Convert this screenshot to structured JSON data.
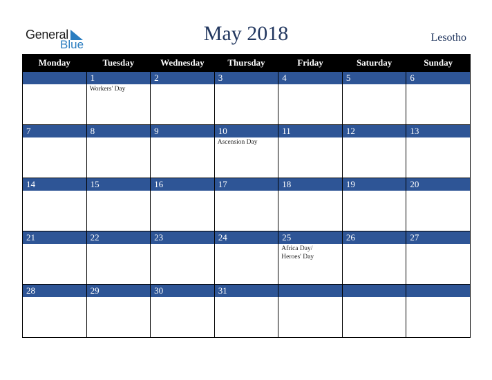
{
  "logo": {
    "line1": "General",
    "line2": "Blue"
  },
  "header": {
    "title": "May 2018",
    "country": "Lesotho"
  },
  "colors": {
    "header_bg": "#000000",
    "date_bar": "#2e5596",
    "title": "#22375f",
    "logo_blue": "#2a7dc0"
  },
  "weekdays": [
    "Monday",
    "Tuesday",
    "Wednesday",
    "Thursday",
    "Friday",
    "Saturday",
    "Sunday"
  ],
  "weeks": [
    [
      {
        "day": "",
        "holiday": ""
      },
      {
        "day": "1",
        "holiday": "Workers' Day"
      },
      {
        "day": "2",
        "holiday": ""
      },
      {
        "day": "3",
        "holiday": ""
      },
      {
        "day": "4",
        "holiday": ""
      },
      {
        "day": "5",
        "holiday": ""
      },
      {
        "day": "6",
        "holiday": ""
      }
    ],
    [
      {
        "day": "7",
        "holiday": ""
      },
      {
        "day": "8",
        "holiday": ""
      },
      {
        "day": "9",
        "holiday": ""
      },
      {
        "day": "10",
        "holiday": "Ascension Day"
      },
      {
        "day": "11",
        "holiday": ""
      },
      {
        "day": "12",
        "holiday": ""
      },
      {
        "day": "13",
        "holiday": ""
      }
    ],
    [
      {
        "day": "14",
        "holiday": ""
      },
      {
        "day": "15",
        "holiday": ""
      },
      {
        "day": "16",
        "holiday": ""
      },
      {
        "day": "17",
        "holiday": ""
      },
      {
        "day": "18",
        "holiday": ""
      },
      {
        "day": "19",
        "holiday": ""
      },
      {
        "day": "20",
        "holiday": ""
      }
    ],
    [
      {
        "day": "21",
        "holiday": ""
      },
      {
        "day": "22",
        "holiday": ""
      },
      {
        "day": "23",
        "holiday": ""
      },
      {
        "day": "24",
        "holiday": ""
      },
      {
        "day": "25",
        "holiday": "Africa Day/ Heroes' Day"
      },
      {
        "day": "26",
        "holiday": ""
      },
      {
        "day": "27",
        "holiday": ""
      }
    ],
    [
      {
        "day": "28",
        "holiday": ""
      },
      {
        "day": "29",
        "holiday": ""
      },
      {
        "day": "30",
        "holiday": ""
      },
      {
        "day": "31",
        "holiday": ""
      },
      {
        "day": "",
        "holiday": ""
      },
      {
        "day": "",
        "holiday": ""
      },
      {
        "day": "",
        "holiday": ""
      }
    ]
  ]
}
